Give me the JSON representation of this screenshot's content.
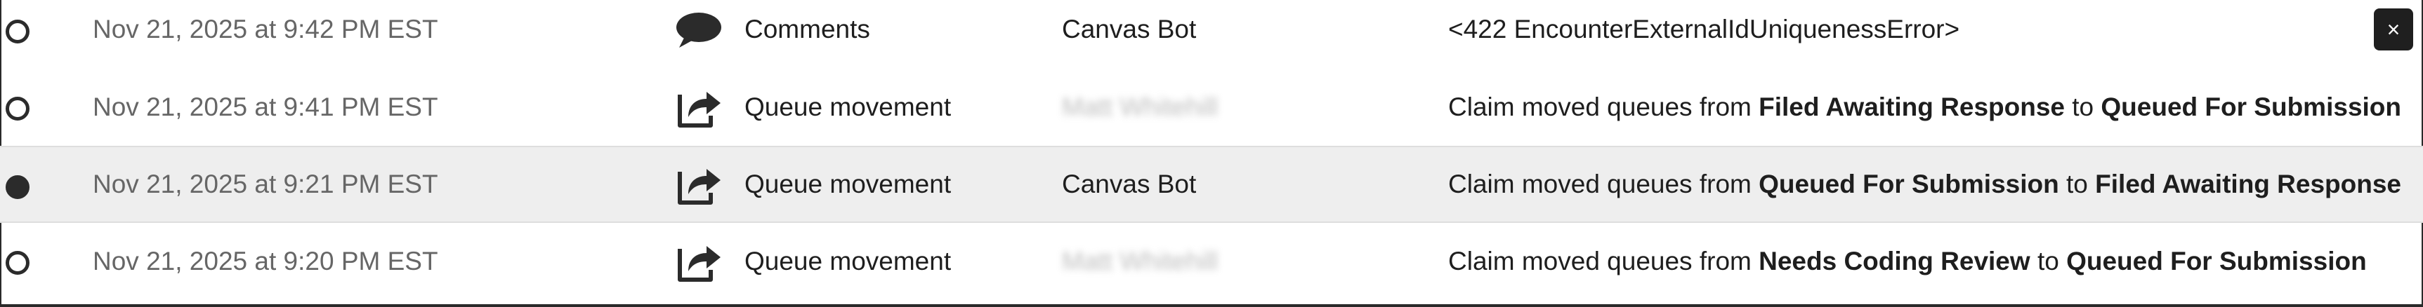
{
  "rows": [
    {
      "timestamp": "Nov 21, 2025 at 9:42 PM EST",
      "icon": "comment-icon",
      "type": "Comments",
      "actor": "Canvas Bot",
      "description": {
        "text": "<422 EncounterExternalIdUniquenessError>"
      },
      "selected": false
    },
    {
      "timestamp": "Nov 21, 2025 at 9:41 PM EST",
      "icon": "queue-movement-icon",
      "type": "Queue movement",
      "actor": "Matt Whitehill",
      "actor_redacted": true,
      "description": {
        "prefix": "Claim moved queues from ",
        "from": "Filed Awaiting Response",
        "to_word": " to ",
        "to": "Queued For Submission"
      },
      "selected": false
    },
    {
      "timestamp": "Nov 21, 2025 at 9:21 PM EST",
      "icon": "queue-movement-icon",
      "type": "Queue movement",
      "actor": "Canvas Bot",
      "description": {
        "prefix": "Claim moved queues from ",
        "from": "Queued For Submission",
        "to_word": " to ",
        "to": "Filed Awaiting Response"
      },
      "selected": true
    },
    {
      "timestamp": "Nov 21, 2025 at 9:20 PM EST",
      "icon": "queue-movement-icon",
      "type": "Queue movement",
      "actor": "Matt Whitehill",
      "actor_redacted": true,
      "description": {
        "prefix": "Claim moved queues from ",
        "from": "Needs Coding Review",
        "to_word": " to ",
        "to": "Queued For Submission"
      },
      "selected": false
    }
  ],
  "close_button": {
    "label": "×",
    "icon": "close-icon"
  },
  "colors": {
    "selected_row_bg": "#eeeeee",
    "timestamp": "#666666",
    "text": "#1e1e1e",
    "close_bg": "#1f1f1f"
  }
}
